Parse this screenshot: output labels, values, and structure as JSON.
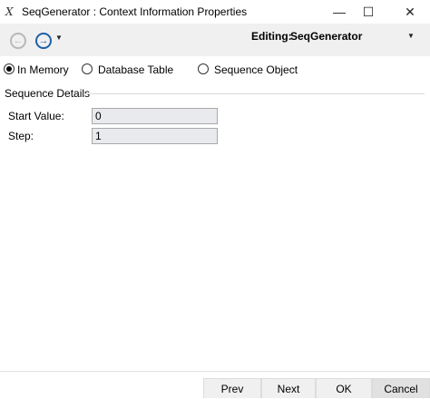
{
  "window": {
    "icon_glyph": "𝑋",
    "title": "SeqGenerator : Context Information Properties",
    "minimize_glyph": "—",
    "maximize_glyph": "☐",
    "close_glyph": "✕"
  },
  "toolbar": {
    "back_glyph": "←",
    "forward_glyph": "→",
    "dropdown_glyph": "▼",
    "editing_label": "Editing:",
    "editing_value": "SeqGenerator"
  },
  "storage": {
    "options": [
      {
        "label": "In Memory",
        "checked": true
      },
      {
        "label": "Database Table",
        "checked": false
      },
      {
        "label": "Sequence Object",
        "checked": false
      }
    ]
  },
  "sequence_details": {
    "title": "Sequence Details",
    "fields": [
      {
        "label": "Start Value:",
        "value": "0"
      },
      {
        "label": "Step:",
        "value": "1"
      }
    ]
  },
  "footer": {
    "prev": "Prev",
    "next": "Next",
    "ok": "OK",
    "cancel": "Cancel"
  }
}
